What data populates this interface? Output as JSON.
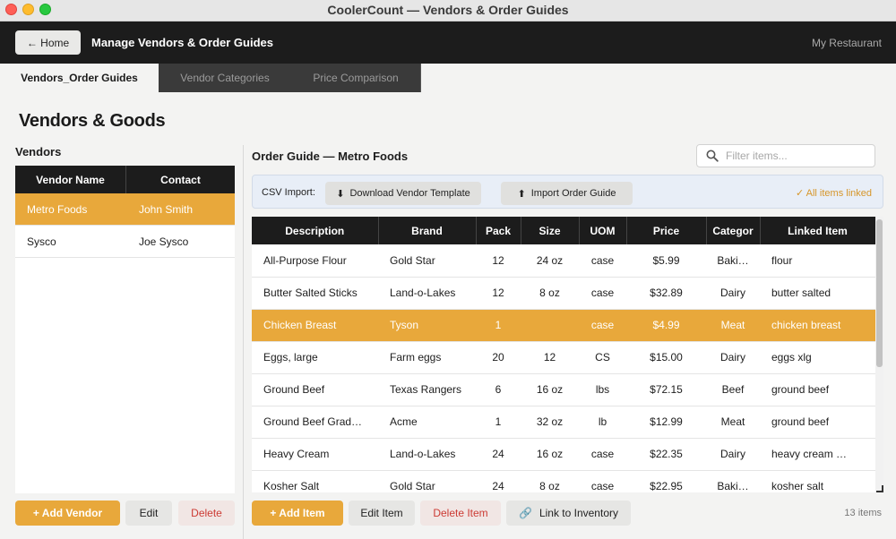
{
  "window": {
    "title": "CoolerCount — Vendors & Order Guides"
  },
  "header": {
    "home_label": "← Home",
    "title": "Manage Vendors & Order Guides",
    "restaurant": "My Restaurant"
  },
  "tabs": [
    {
      "label": "Vendors_Order Guides",
      "active": true
    },
    {
      "label": "Vendor Categories",
      "active": false
    },
    {
      "label": "Price Comparison",
      "active": false
    }
  ],
  "page_heading": "Vendors & Goods",
  "vendors": {
    "label": "Vendors",
    "columns": [
      "Vendor Name",
      "Contact"
    ],
    "rows": [
      {
        "name": "Metro Foods",
        "contact": "John Smith",
        "selected": true
      },
      {
        "name": "Sysco",
        "contact": "Joe Sysco",
        "selected": false
      }
    ],
    "buttons": {
      "add": "+ Add Vendor",
      "edit": "Edit",
      "delete": "Delete"
    }
  },
  "order_guide": {
    "title": "Order Guide — Metro Foods",
    "filter_placeholder": "Filter items...",
    "csv": {
      "label": "CSV Import:",
      "download_label": "Download Vendor Template",
      "import_label": "Import Order Guide",
      "status": "✓ All items linked"
    },
    "columns": [
      "Description",
      "Brand",
      "Pack",
      "Size",
      "UOM",
      "Price",
      "Categor",
      "Linked Item"
    ],
    "rows": [
      [
        "All-Purpose Flour",
        "Gold Star",
        "12",
        "24 oz",
        "case",
        "$5.99",
        "Baki…",
        "flour"
      ],
      [
        "Butter Salted Sticks",
        "Land-o-Lakes",
        "12",
        "8 oz",
        "case",
        "$32.89",
        "Dairy",
        "butter salted"
      ],
      [
        "Chicken Breast",
        "Tyson",
        "1",
        "",
        "case",
        "$4.99",
        "Meat",
        "chicken breast"
      ],
      [
        "Eggs, large",
        "Farm eggs",
        "20",
        "12",
        "CS",
        "$15.00",
        "Dairy",
        "eggs xlg"
      ],
      [
        "Ground Beef",
        "Texas Rangers",
        "6",
        "16 oz",
        "lbs",
        "$72.15",
        "Beef",
        "ground beef"
      ],
      [
        "Ground Beef Grad…",
        "Acme",
        "1",
        "32 oz",
        "lb",
        "$12.99",
        "Meat",
        "ground beef"
      ],
      [
        "Heavy Cream",
        "Land-o-Lakes",
        "24",
        "16 oz",
        "case",
        "$22.35",
        "Dairy",
        "heavy cream …"
      ],
      [
        "Kosher Salt",
        "Gold Star",
        "24",
        "8 oz",
        "case",
        "$22.95",
        "Baki…",
        "kosher salt"
      ]
    ],
    "selected_row": 2,
    "buttons": {
      "add": "+ Add Item",
      "edit": "Edit Item",
      "delete": "Delete Item",
      "link": "Link to Inventory"
    },
    "count": "13 items"
  },
  "colors": {
    "accent": "#e8a83b",
    "header": "#1c1c1c",
    "danger": "#cc3b34"
  }
}
